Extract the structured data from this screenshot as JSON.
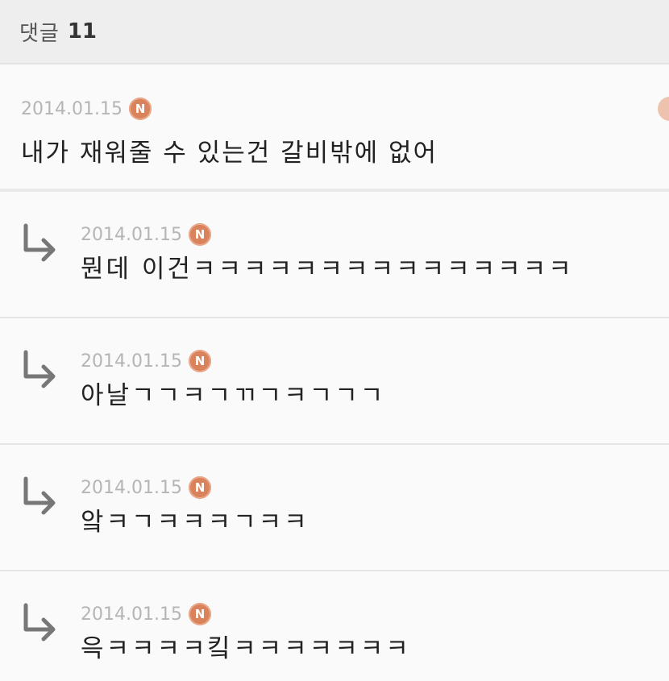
{
  "header": {
    "label": "댓글",
    "count": "11"
  },
  "comment": {
    "date": "2014.01.15",
    "badge": "N",
    "text": "내가 재워줄 수 있는건 갈비밖에 없어"
  },
  "replies": [
    {
      "date": "2014.01.15",
      "badge": "N",
      "text": "뭔데 이건ㅋㅋㅋㅋㅋㅋㅋㅋㅋㅋㅋㅋㅋㅋㅋ"
    },
    {
      "date": "2014.01.15",
      "badge": "N",
      "text": "아날ㄱㄱㅋㄱㄲㄱㅋㄱㄱㄱ"
    },
    {
      "date": "2014.01.15",
      "badge": "N",
      "text": "앜ㅋㄱㅋㅋㅋㄱㅋㅋ"
    },
    {
      "date": "2014.01.15",
      "badge": "N",
      "text": "윽ㅋㅋㅋㅋ킼ㅋㅋㅋㅋㅋㅋㅋ"
    }
  ],
  "colors": {
    "badge": "#d9825b",
    "date": "#b5b5b5",
    "text": "#222222",
    "arrow": "#777777"
  },
  "icons": {
    "reply": "reply-arrow-icon",
    "new": "new-badge-icon"
  }
}
